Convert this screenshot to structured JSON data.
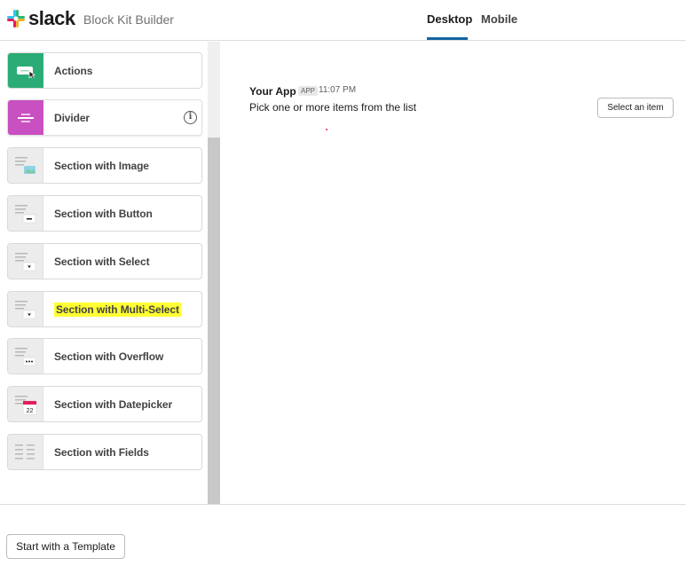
{
  "header": {
    "brand": "slack",
    "subtitle": "Block Kit Builder",
    "tabs": [
      {
        "label": "Desktop",
        "active": true
      },
      {
        "label": "Mobile",
        "active": false
      }
    ],
    "accent_color": "#1264a3"
  },
  "sidebar": {
    "blocks": [
      {
        "label": "Actions",
        "icon": "actions-icon",
        "color": "#2bac76"
      },
      {
        "label": "Divider",
        "icon": "divider-icon",
        "color": "#c850c0",
        "info_icon": "i"
      },
      {
        "label": "Section with Image",
        "icon": "section-image-icon"
      },
      {
        "label": "Section with Button",
        "icon": "section-button-icon"
      },
      {
        "label": "Section with Select",
        "icon": "section-select-icon"
      },
      {
        "label": "Section with Multi-Select",
        "icon": "section-multiselect-icon",
        "highlighted": true
      },
      {
        "label": "Section with Overflow",
        "icon": "section-overflow-icon"
      },
      {
        "label": "Section with Datepicker",
        "icon": "section-datepicker-icon",
        "calendar_day": "22"
      },
      {
        "label": "Section with Fields",
        "icon": "section-fields-icon"
      }
    ]
  },
  "preview": {
    "app_name": "Your App",
    "app_badge": "APP",
    "time": "11:07 PM",
    "message": "Pick one or more items from the list",
    "select_button": "Select an item"
  },
  "footer": {
    "template_button": "Start with a Template"
  }
}
